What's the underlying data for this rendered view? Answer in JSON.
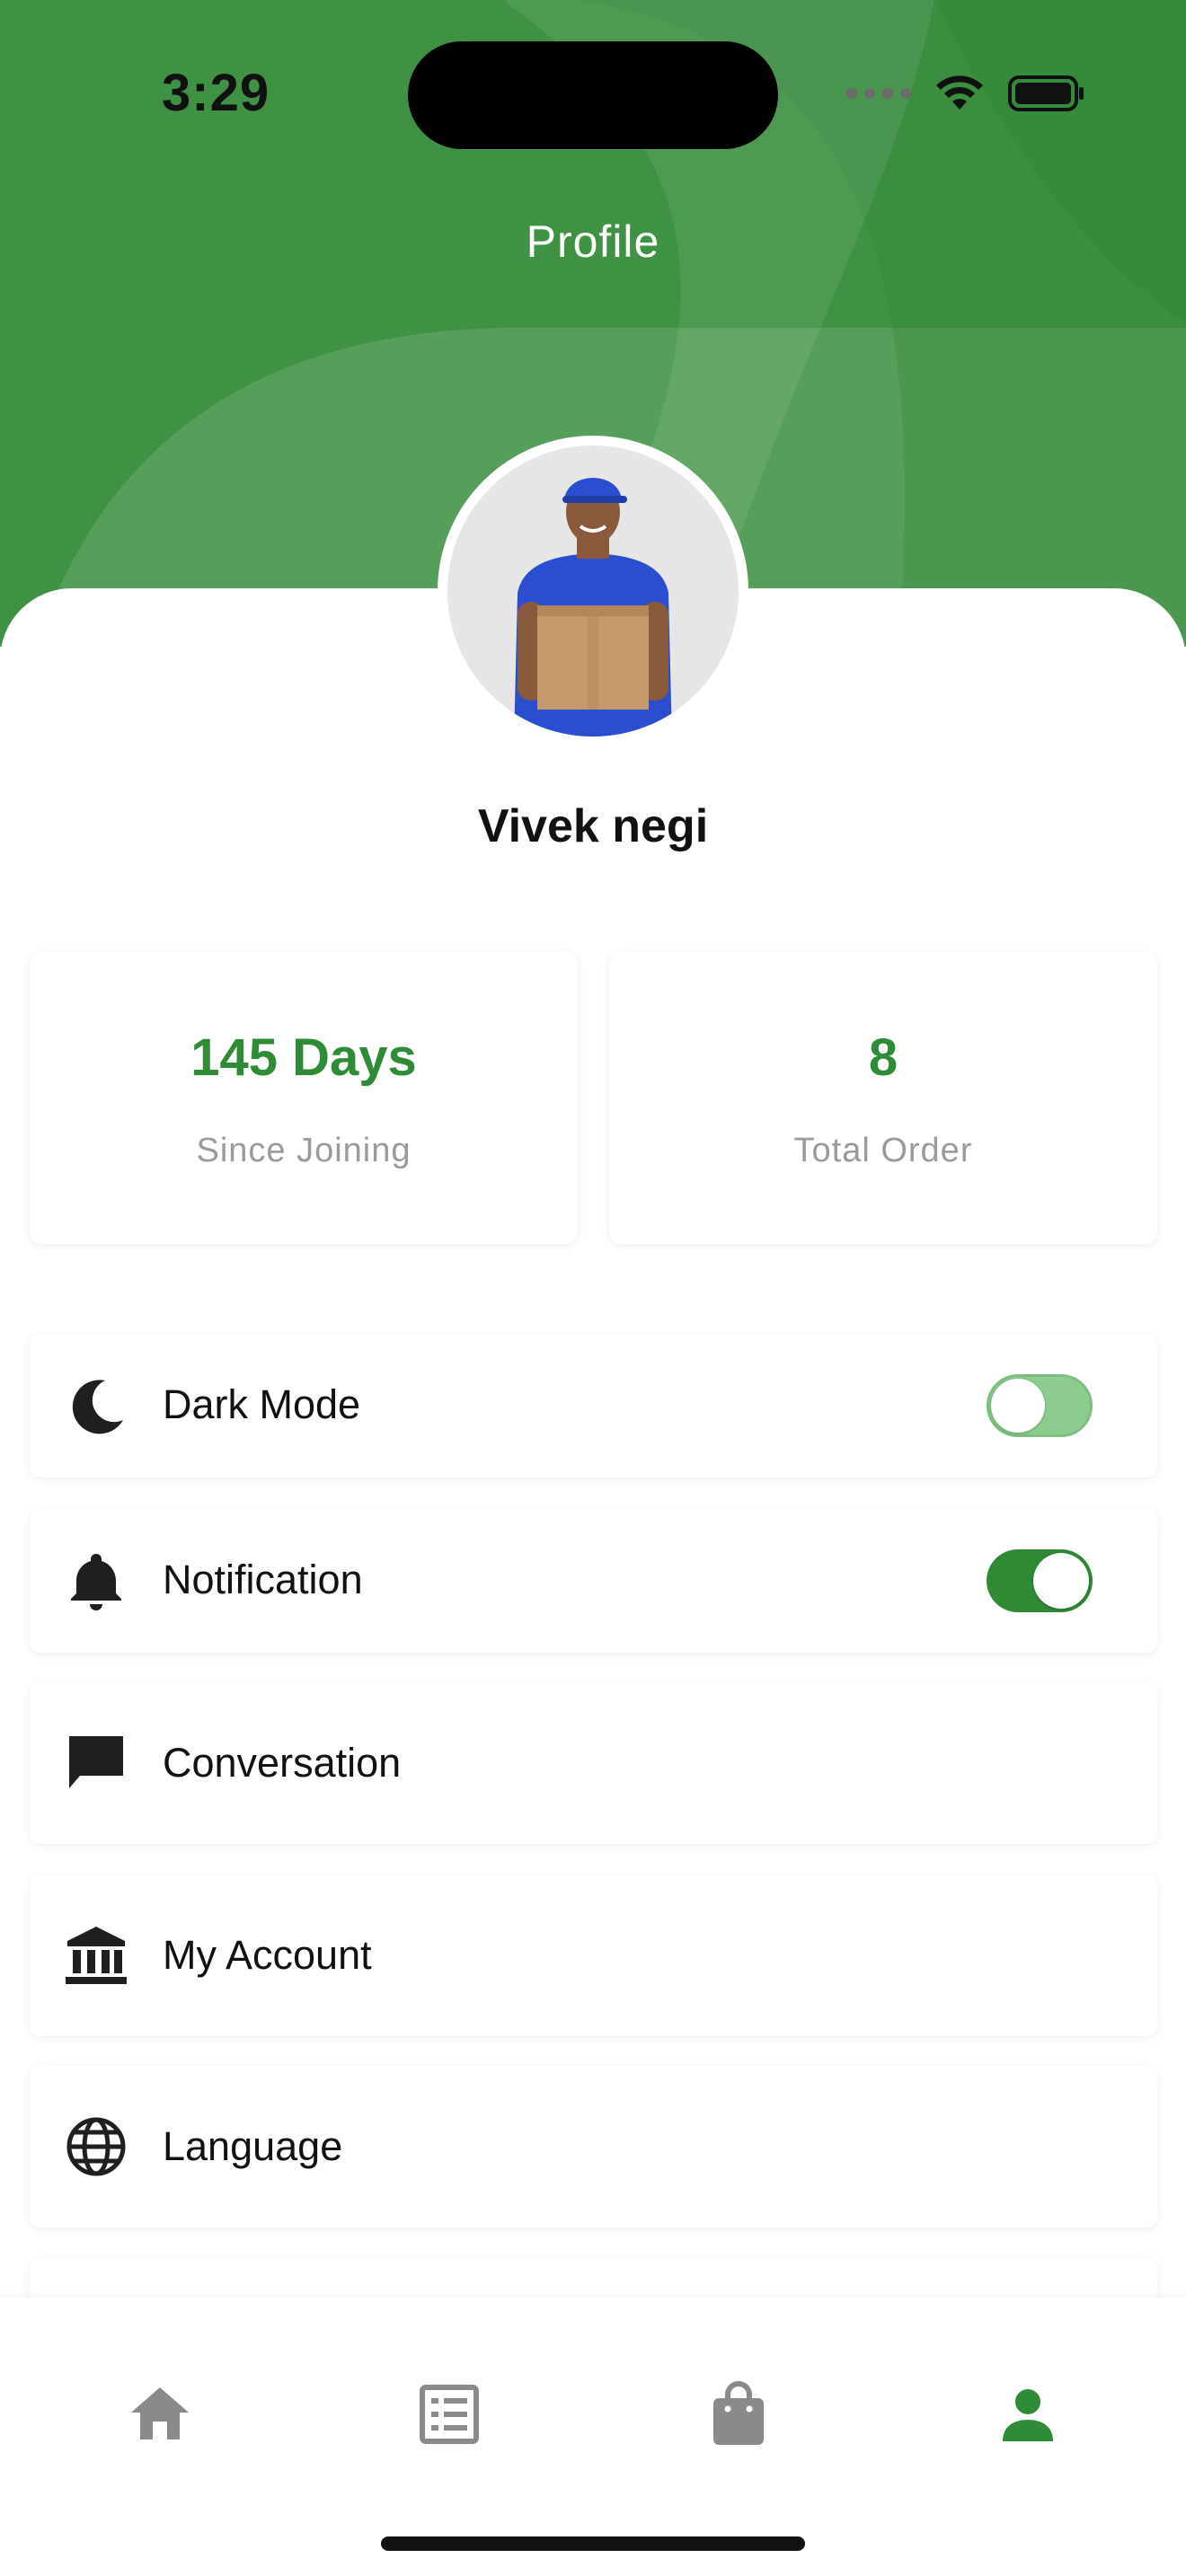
{
  "status_bar": {
    "time": "3:29"
  },
  "header": {
    "title": "Profile",
    "color": "#3f9244"
  },
  "profile": {
    "name": "Vivek negi"
  },
  "stats": [
    {
      "value": "145 Days",
      "label": "Since Joining"
    },
    {
      "value": "8",
      "label": "Total Order"
    }
  ],
  "menu": {
    "items": [
      {
        "label": "Dark Mode",
        "icon": "moon-icon",
        "toggle": "off"
      },
      {
        "label": "Notification",
        "icon": "bell-icon",
        "toggle": "on"
      },
      {
        "label": "Conversation",
        "icon": "chat-icon"
      },
      {
        "label": "My Account",
        "icon": "bank-icon"
      },
      {
        "label": "Language",
        "icon": "globe-icon"
      }
    ]
  },
  "bottom_nav": {
    "items": [
      {
        "icon": "home-icon",
        "active": false
      },
      {
        "icon": "orders-list-icon",
        "active": false
      },
      {
        "icon": "shopping-bag-icon",
        "active": false
      },
      {
        "icon": "profile-icon",
        "active": true
      }
    ]
  },
  "colors": {
    "accent": "#2e8b36",
    "inactive_icon": "#8a8a8a",
    "active_icon": "#2e8b36"
  }
}
